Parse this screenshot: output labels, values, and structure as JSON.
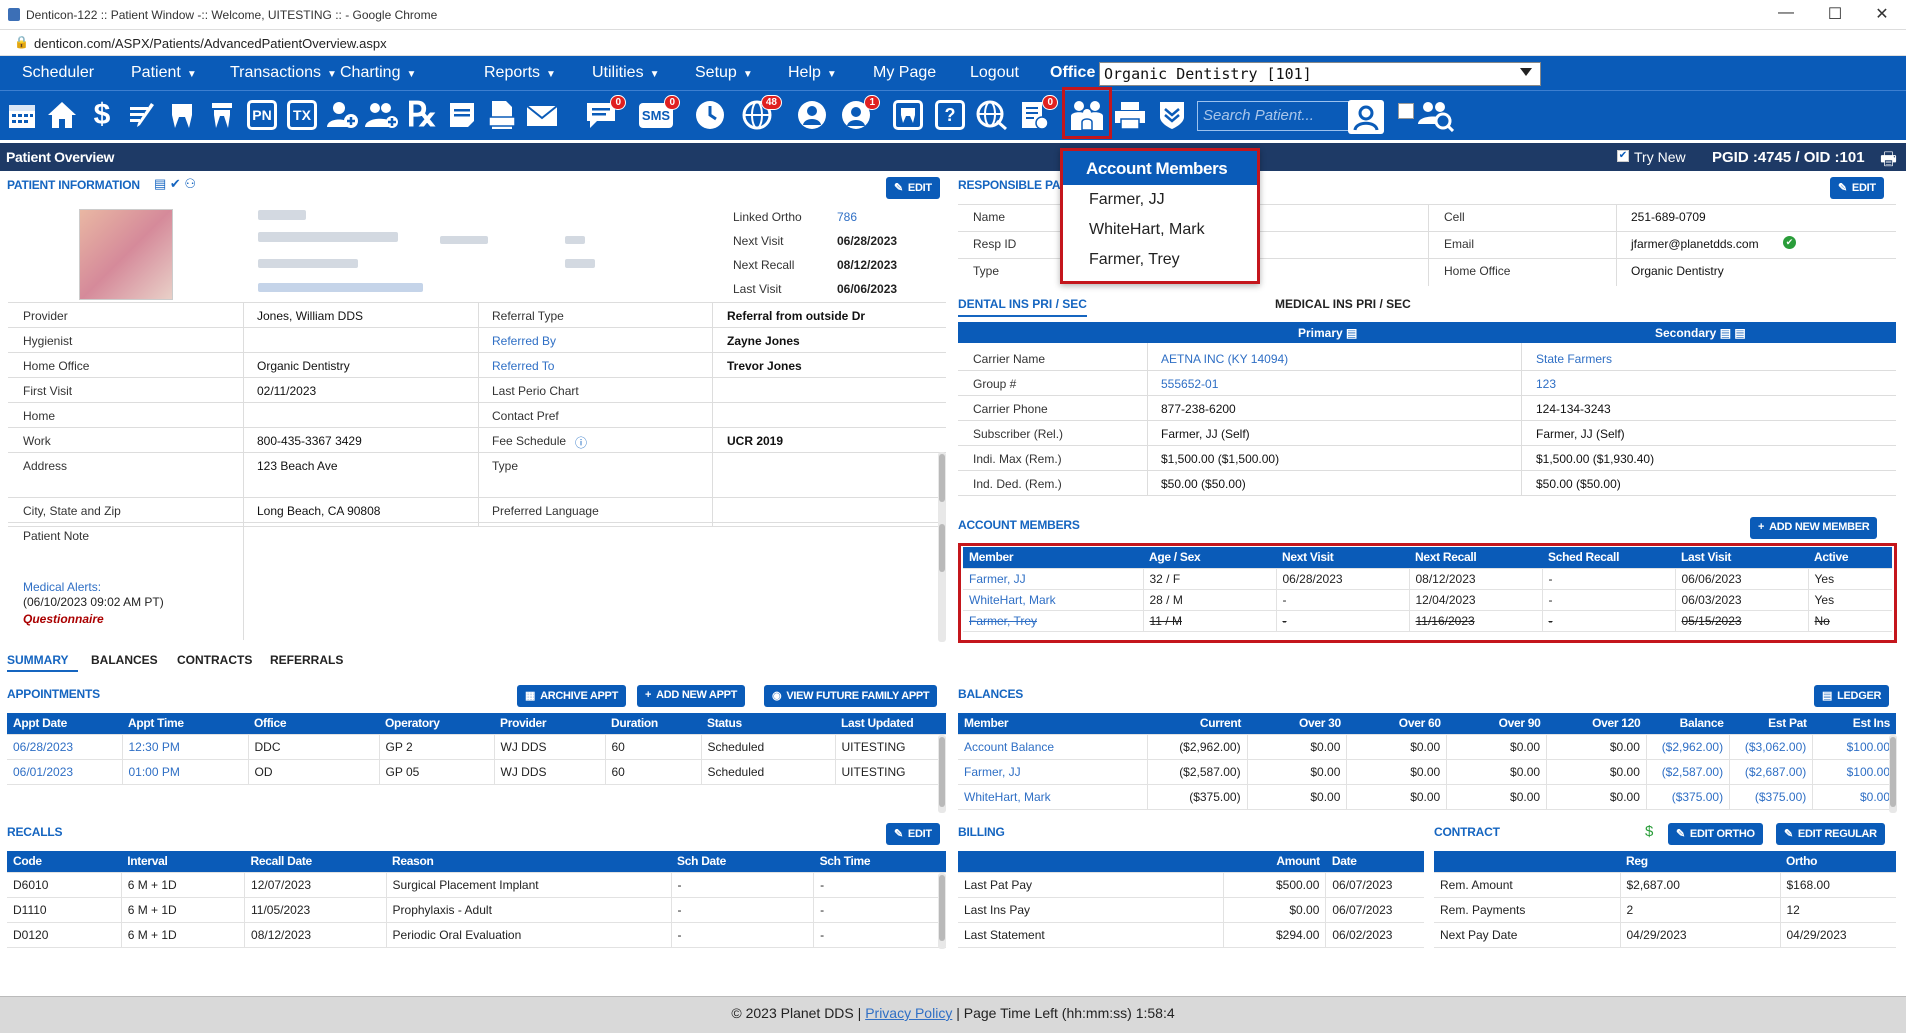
{
  "browser": {
    "title": "Denticon-122 :: Patient Window -:: Welcome, UITESTING :: - Google Chrome",
    "url": "denticon.com/ASPX/Patients/AdvancedPatientOverview.aspx",
    "minimize": "—",
    "maximize": "☐",
    "close": "✕"
  },
  "menu": {
    "items": [
      "Scheduler",
      "Patient",
      "Transactions",
      "Charting",
      "Reports",
      "Utilities",
      "Setup",
      "Help",
      "My Page",
      "Logout"
    ],
    "has_caret": [
      false,
      true,
      true,
      true,
      true,
      true,
      true,
      true,
      false,
      false
    ],
    "office_label": "Office",
    "office_value": "Organic Dentistry [101]"
  },
  "toolbar": {
    "icons": [
      "calendar-icon",
      "home-icon",
      "dollar-icon",
      "pen-icon",
      "tooth-icon",
      "tooth2-icon",
      "pn-icon",
      "tx-icon",
      "add-person-icon",
      "add-family-icon",
      "rx-icon",
      "note-icon",
      "document-icon",
      "mail-icon",
      "chat-icon",
      "sms-icon",
      "clock-icon",
      "globe-icon",
      "person-alert-icon",
      "doctor-icon",
      "tooth-box-icon",
      "question-icon",
      "web-icon",
      "checklist-icon",
      "family-icon",
      "print-icon",
      "shield-icon",
      "user-search-icon",
      "group-search-icon"
    ],
    "badges": {
      "chat": "0",
      "sms": "0",
      "globe": "48",
      "person_alert": "1",
      "checklist": "0"
    },
    "search_placeholder": "Search Patient..."
  },
  "overview": {
    "title": "Patient Overview",
    "try_new": "Try New",
    "pgid": "PGID :4745  /  OID :101"
  },
  "account_popup": {
    "title": "Account Members",
    "members": [
      "Farmer, JJ",
      "WhiteHart, Mark",
      "Farmer, Trey"
    ]
  },
  "patient_info": {
    "title": "PATIENT INFORMATION",
    "edit": "EDIT",
    "linked": [
      {
        "label": "Linked Ortho",
        "value": "786"
      },
      {
        "label": "Next Visit",
        "value": "06/28/2023"
      },
      {
        "label": "Next Recall",
        "value": "08/12/2023"
      },
      {
        "label": "Last Visit",
        "value": "06/06/2023"
      }
    ],
    "rows": [
      {
        "l1": "Provider",
        "v1": "Jones, William DDS",
        "l2": "Referral Type",
        "v2": "Referral from outside Dr"
      },
      {
        "l1": "Hygienist",
        "v1": "",
        "l2": "Referred By",
        "v2": "Zayne Jones"
      },
      {
        "l1": "Home Office",
        "v1": "Organic Dentistry",
        "l2": "Referred To",
        "v2": "Trevor Jones"
      },
      {
        "l1": "First Visit",
        "v1": "02/11/2023",
        "l2": "Last Perio Chart",
        "v2": ""
      },
      {
        "l1": "Home",
        "v1": "",
        "l2": "Contact Pref",
        "v2": ""
      },
      {
        "l1": "Work",
        "v1": "800-435-3367 3429",
        "l2": "Fee Schedule",
        "v2": "UCR 2019"
      },
      {
        "l1": "Address",
        "v1": "123 Beach Ave",
        "l2": "Type",
        "v2": ""
      },
      {
        "l1": "City, State and Zip",
        "v1": "Long Beach, CA 90808",
        "l2": "Preferred Language",
        "v2": ""
      },
      {
        "l1": "Patient Note",
        "v1": "",
        "l2": "",
        "v2": ""
      }
    ],
    "medical_alerts": "Medical Alerts:",
    "medical_date": "(06/10/2023 09:02 AM PT)",
    "questionnaire": "Questionnaire"
  },
  "responsible": {
    "title": "RESPONSIBLE PA",
    "edit": "EDIT",
    "left": [
      {
        "label": "Name",
        "value": ""
      },
      {
        "label": "Resp ID",
        "value": ""
      },
      {
        "label": "Type",
        "value": ""
      }
    ],
    "right": [
      {
        "label": "Cell",
        "value": "251-689-0709"
      },
      {
        "label": "Email",
        "value": "jfarmer@planetdds.com"
      },
      {
        "label": "Home Office",
        "value": "Organic Dentistry"
      }
    ]
  },
  "insurance": {
    "tab_dental": "DENTAL INS PRI / SEC",
    "tab_medical": "MEDICAL INS PRI / SEC",
    "primary": "Primary",
    "secondary": "Secondary",
    "rows": [
      {
        "label": "Carrier Name",
        "p": "AETNA INC (KY 14094)",
        "s": "State Farmers",
        "link": true
      },
      {
        "label": "Group #",
        "p": "555652-01",
        "s": "123",
        "link": true
      },
      {
        "label": "Carrier Phone",
        "p": "877-238-6200",
        "s": "124-134-3243",
        "link": false
      },
      {
        "label": "Subscriber (Rel.)",
        "p": "Farmer, JJ (Self)",
        "s": "Farmer, JJ (Self)",
        "link": false
      },
      {
        "label": "Indi. Max (Rem.)",
        "p": "$1,500.00 ($1,500.00)",
        "s": "$1,500.00 ($1,930.40)",
        "link": false
      },
      {
        "label": "Ind. Ded. (Rem.)",
        "p": "$50.00 ($50.00)",
        "s": "$50.00 ($50.00)",
        "link": false
      }
    ]
  },
  "account_members": {
    "title": "ACCOUNT MEMBERS",
    "add_btn": "ADD NEW MEMBER",
    "headers": [
      "Member",
      "Age / Sex",
      "Next Visit",
      "Next Recall",
      "Sched Recall",
      "Last Visit",
      "Active"
    ],
    "rows": [
      [
        "Farmer, JJ",
        "32 / F",
        "06/28/2023",
        "08/12/2023",
        "-",
        "06/06/2023",
        "Yes"
      ],
      [
        "WhiteHart, Mark",
        "28 / M",
        "-",
        "12/04/2023",
        "-",
        "06/03/2023",
        "Yes"
      ],
      [
        "Farmer, Trey",
        "11 / M",
        "-",
        "11/16/2023",
        "-",
        "05/15/2023",
        "No"
      ]
    ]
  },
  "tabs": [
    "SUMMARY",
    "BALANCES",
    "CONTRACTS",
    "REFERRALS"
  ],
  "appointments": {
    "title": "APPOINTMENTS",
    "btn_archive": "ARCHIVE APPT",
    "btn_add": "ADD NEW APPT",
    "btn_future": "VIEW FUTURE FAMILY APPT",
    "headers": [
      "Appt Date",
      "Appt Time",
      "Office",
      "Operatory",
      "Provider",
      "Duration",
      "Status",
      "Last Updated"
    ],
    "rows": [
      [
        "06/28/2023",
        "12:30 PM",
        "DDC",
        "GP 2",
        "WJ DDS",
        "60",
        "Scheduled",
        "UITESTING"
      ],
      [
        "06/01/2023",
        "01:00 PM",
        "OD",
        "GP 05",
        "WJ DDS",
        "60",
        "Scheduled",
        "UITESTING"
      ]
    ]
  },
  "balances": {
    "title": "BALANCES",
    "btn_ledger": "LEDGER",
    "headers": [
      "Member",
      "Current",
      "Over 30",
      "Over 60",
      "Over 90",
      "Over 120",
      "Balance",
      "Est Pat",
      "Est Ins"
    ],
    "rows": [
      [
        "Account Balance",
        "($2,962.00)",
        "$0.00",
        "$0.00",
        "$0.00",
        "$0.00",
        "($2,962.00)",
        "($3,062.00)",
        "$100.00"
      ],
      [
        "Farmer, JJ",
        "($2,587.00)",
        "$0.00",
        "$0.00",
        "$0.00",
        "$0.00",
        "($2,587.00)",
        "($2,687.00)",
        "$100.00"
      ],
      [
        "WhiteHart, Mark",
        "($375.00)",
        "$0.00",
        "$0.00",
        "$0.00",
        "$0.00",
        "($375.00)",
        "($375.00)",
        "$0.00"
      ]
    ]
  },
  "recalls": {
    "title": "RECALLS",
    "edit": "EDIT",
    "headers": [
      "Code",
      "Interval",
      "Recall Date",
      "Reason",
      "Sch Date",
      "Sch Time"
    ],
    "rows": [
      [
        "D6010",
        "6 M + 1D",
        "12/07/2023",
        "Surgical Placement Implant",
        "-",
        "-"
      ],
      [
        "D1110",
        "6 M + 1D",
        "11/05/2023",
        "Prophylaxis - Adult",
        "-",
        "-"
      ],
      [
        "D0120",
        "6 M + 1D",
        "08/12/2023",
        "Periodic Oral Evaluation",
        "-",
        "-"
      ]
    ]
  },
  "billing": {
    "title": "BILLING",
    "headers": [
      "",
      "Amount",
      "Date"
    ],
    "rows": [
      [
        "Last Pat Pay",
        "$500.00",
        "06/07/2023"
      ],
      [
        "Last Ins Pay",
        "$0.00",
        "06/07/2023"
      ],
      [
        "Last Statement",
        "$294.00",
        "06/02/2023"
      ]
    ]
  },
  "contract": {
    "title": "CONTRACT",
    "btn_ortho": "EDIT ORTHO",
    "btn_regular": "EDIT REGULAR",
    "headers": [
      "",
      "Reg",
      "Ortho"
    ],
    "rows": [
      [
        "Rem. Amount",
        "$2,687.00",
        "$168.00"
      ],
      [
        "Rem. Payments",
        "2",
        "12"
      ],
      [
        "Next Pay Date",
        "04/29/2023",
        "04/29/2023"
      ]
    ]
  },
  "footer": {
    "copyright": "© 2023 Planet DDS |",
    "privacy": "Privacy Policy",
    "time_left": "| Page Time Left (hh:mm:ss) 1:58:4"
  },
  "colors": {
    "brand": "#0a5bb8",
    "header_dark": "#1e3a66",
    "link": "#2f6fc5",
    "highlight": "#c4161c"
  }
}
